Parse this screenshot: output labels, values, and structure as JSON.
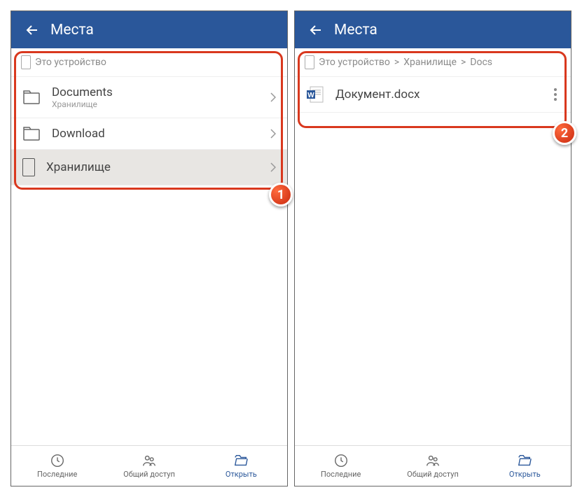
{
  "left": {
    "header": {
      "title": "Места"
    },
    "breadcrumb": "Это устройство",
    "items": [
      {
        "title": "Documents",
        "sub": "Хранилище",
        "type": "folder"
      },
      {
        "title": "Download",
        "sub": "",
        "type": "folder"
      },
      {
        "title": "Хранилище",
        "sub": "",
        "type": "device",
        "selected": true
      }
    ],
    "badge": "1"
  },
  "right": {
    "header": {
      "title": "Места"
    },
    "breadcrumb": {
      "p1": "Это устройство",
      "p2": "Хранилище",
      "p3": "Docs",
      "sep": ">"
    },
    "file": {
      "title": "Документ.docx"
    },
    "badge": "2"
  },
  "nav": {
    "recent": "Последние",
    "shared": "Общий доступ",
    "open": "Открыть"
  }
}
